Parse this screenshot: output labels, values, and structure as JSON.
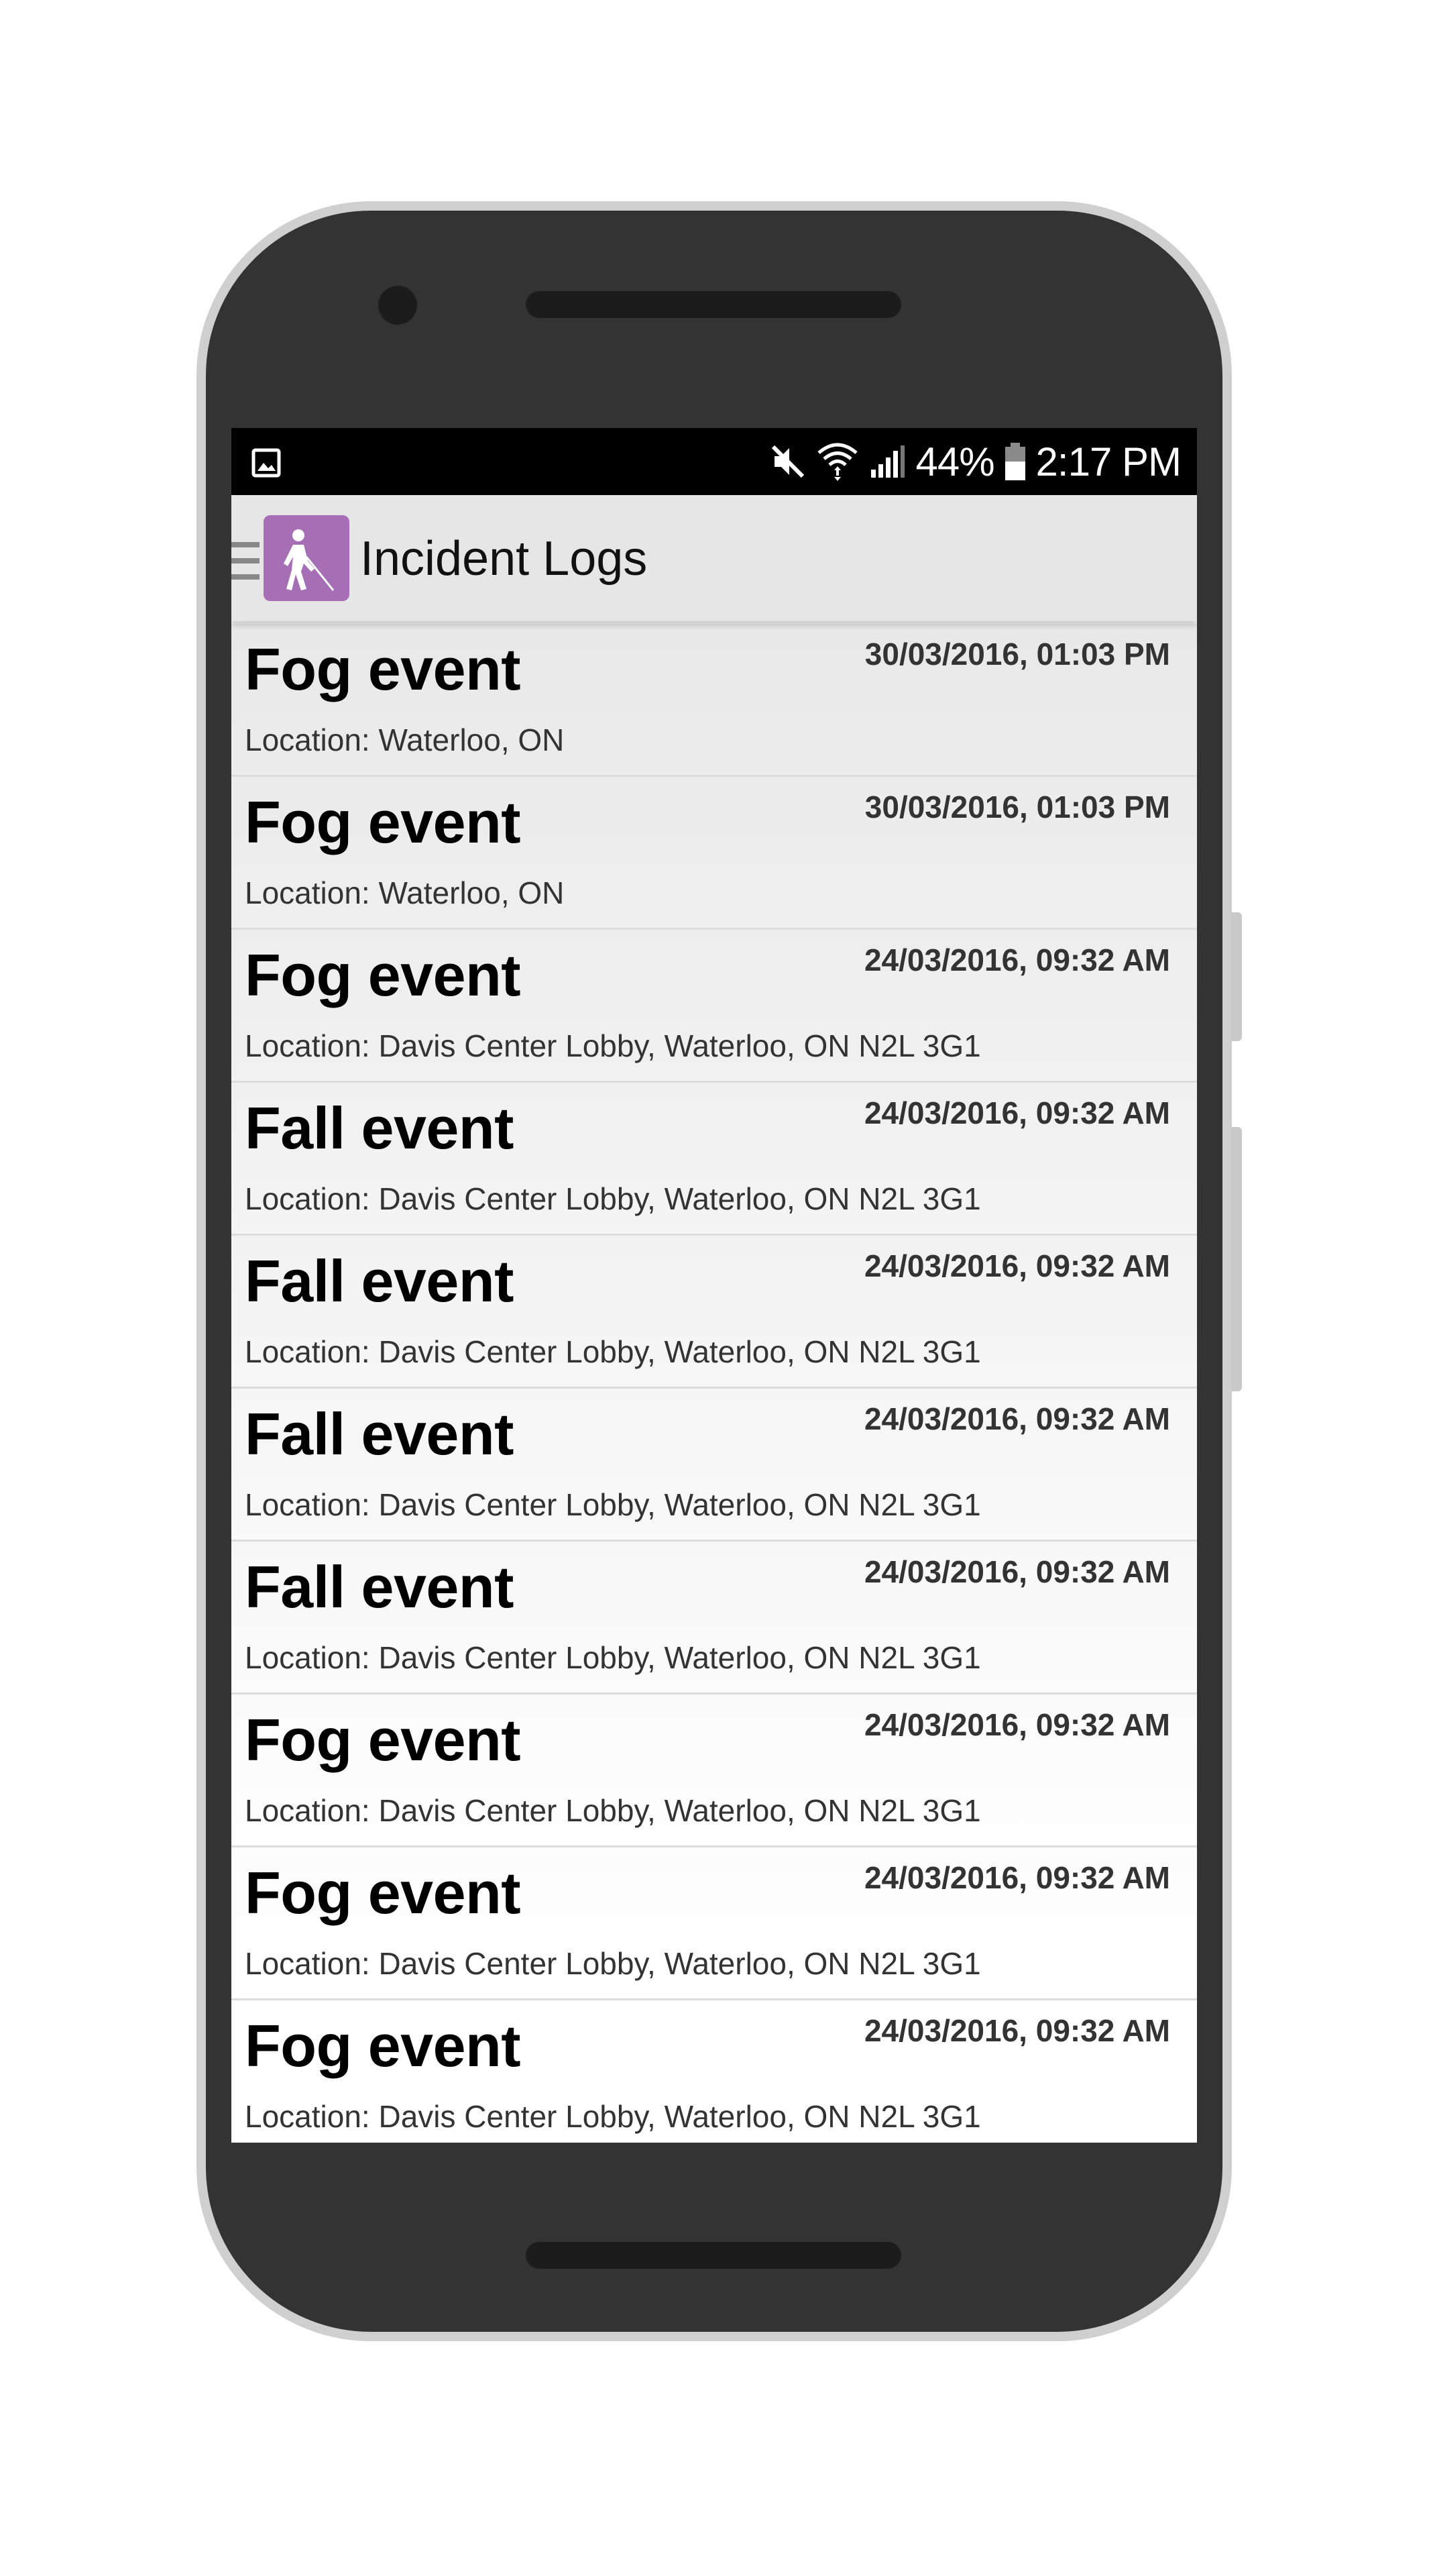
{
  "status_bar": {
    "battery_percent": "44%",
    "time": "2:17 PM"
  },
  "app_bar": {
    "title": "Incident Logs"
  },
  "incidents": [
    {
      "title": "Fog event",
      "datetime": "30/03/2016, 01:03 PM",
      "location": "Location: Waterloo, ON"
    },
    {
      "title": "Fog event",
      "datetime": "30/03/2016, 01:03 PM",
      "location": "Location: Waterloo, ON"
    },
    {
      "title": "Fog event",
      "datetime": "24/03/2016, 09:32 AM",
      "location": "Location: Davis Center Lobby, Waterloo, ON N2L 3G1"
    },
    {
      "title": "Fall event",
      "datetime": "24/03/2016, 09:32 AM",
      "location": "Location: Davis Center Lobby, Waterloo, ON N2L 3G1"
    },
    {
      "title": "Fall event",
      "datetime": "24/03/2016, 09:32 AM",
      "location": "Location: Davis Center Lobby, Waterloo, ON N2L 3G1"
    },
    {
      "title": "Fall event",
      "datetime": "24/03/2016, 09:32 AM",
      "location": "Location: Davis Center Lobby, Waterloo, ON N2L 3G1"
    },
    {
      "title": "Fall event",
      "datetime": "24/03/2016, 09:32 AM",
      "location": "Location: Davis Center Lobby, Waterloo, ON N2L 3G1"
    },
    {
      "title": "Fog event",
      "datetime": "24/03/2016, 09:32 AM",
      "location": "Location: Davis Center Lobby, Waterloo, ON N2L 3G1"
    },
    {
      "title": "Fog event",
      "datetime": "24/03/2016, 09:32 AM",
      "location": "Location: Davis Center Lobby, Waterloo, ON N2L 3G1"
    },
    {
      "title": "Fog event",
      "datetime": "24/03/2016, 09:32 AM",
      "location": "Location: Davis Center Lobby, Waterloo, ON N2L 3G1"
    }
  ],
  "icons": {
    "notification": "gallery-icon",
    "mute": "mute-icon",
    "wifi": "wifi-icon",
    "signal": "signal-icon",
    "battery": "battery-icon",
    "menu": "hamburger-menu-icon",
    "app_logo": "blind-person-cane-icon"
  },
  "colors": {
    "status_bar_bg": "#000000",
    "app_bar_bg": "#e6e6e6",
    "app_logo_bg": "#a66fb5",
    "device_body": "#333333"
  }
}
